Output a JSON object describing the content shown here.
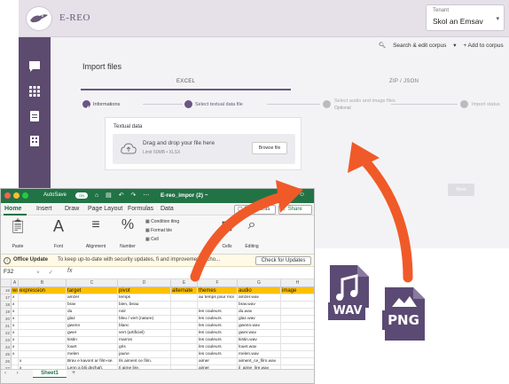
{
  "app": {
    "brand": "E-REO",
    "tenant_label": "Tenant",
    "tenant_value": "Skol an Emsav",
    "actions": {
      "search": "Search & edit corpus",
      "add": "+ Add to corpus"
    },
    "page_title": "Import files",
    "tabs": [
      {
        "label": "EXCEL"
      },
      {
        "label": "ZIP / JSON"
      }
    ],
    "steps": [
      {
        "label": "Informations",
        "state": "done"
      },
      {
        "label": "Select textual data file",
        "state": "active"
      },
      {
        "label": "Select audio and image files",
        "sub": "Optional",
        "state": "todo"
      },
      {
        "label": "Import status",
        "state": "todo"
      }
    ],
    "card": {
      "title": "Textual data",
      "drop_text": "Drag and drop your file here",
      "limit": "Limit 50MB • XLSX",
      "browse": "Browse file"
    },
    "next": "Next",
    "colors": {
      "accent": "#6b5583",
      "sidebar": "#5d4a6f",
      "arrow": "#f05a28"
    }
  },
  "excel": {
    "autosave": "AutoSave",
    "toggle": "ON",
    "filename": "E-reo_impor",
    "filename_suffix": "(2) ~",
    "menu": [
      "Home",
      "Insert",
      "Draw",
      "Page Layout",
      "Formulas",
      "Data"
    ],
    "comments": "Comments",
    "share": "Share",
    "ribbon": {
      "paste": "Paste",
      "font": "Font",
      "alignment": "Alignment",
      "number": "Number",
      "conditional": "Condition",
      "formatting": "tting",
      "format": "Format",
      "format2": "ble",
      "cell": "Cell",
      "cells": "Cells",
      "editing": "Editing"
    },
    "update_title": "Office Update",
    "update_msg": "To keep up-to-date with security updates, fi",
    "update_msg2": "and improvements, cho...",
    "check_updates": "Check for Updates",
    "namebox": "F32",
    "fx": "fx",
    "columns": [
      "A",
      "B",
      "C",
      "D",
      "E",
      "F",
      "G",
      "H"
    ],
    "header_row_num": "16",
    "headers": [
      "word",
      "expression",
      "target",
      "pivot",
      "alternate",
      "themes",
      "audio",
      "image"
    ],
    "rows": [
      {
        "n": "17",
        "cells": [
          "x",
          "",
          "amzer",
          "temps",
          "",
          "au temps pour moi",
          "amzer.wav",
          ""
        ]
      },
      {
        "n": "18",
        "cells": [
          "x",
          "",
          "brav",
          "bien, beau",
          "",
          "",
          "brav.wav",
          ""
        ]
      },
      {
        "n": "19",
        "cells": [
          "x",
          "",
          "du",
          "noir",
          "",
          "les couleurs",
          "du.wav",
          ""
        ]
      },
      {
        "n": "20",
        "cells": [
          "x",
          "",
          "glaz",
          "bleu / vert (nature)",
          "",
          "les couleurs",
          "glaz.wav",
          ""
        ]
      },
      {
        "n": "21",
        "cells": [
          "x",
          "",
          "gwenn",
          "blanc",
          "",
          "les couleurs",
          "gwenn.wav",
          ""
        ]
      },
      {
        "n": "22",
        "cells": [
          "x",
          "",
          "gwer",
          "vert (artificiel)",
          "",
          "les couleurs",
          "gwer.wav",
          ""
        ]
      },
      {
        "n": "23",
        "cells": [
          "x",
          "",
          "kistin",
          "marron",
          "",
          "les couleurs",
          "kistin.wav",
          ""
        ]
      },
      {
        "n": "24",
        "cells": [
          "x",
          "",
          "louet",
          "gris",
          "",
          "les couleurs",
          "louet.wav",
          ""
        ]
      },
      {
        "n": "25",
        "cells": [
          "x",
          "",
          "melen",
          "jaune",
          "",
          "les couleurs",
          "melen.wav",
          ""
        ]
      },
      {
        "n": "26",
        "cells": [
          "",
          "x",
          "Brav e kavont ar film-se.",
          "Ils aiment ce film.",
          "",
          "aimer",
          "aiment_ce_film.wav",
          ""
        ]
      },
      {
        "n": "27",
        "cells": [
          "",
          "x",
          "Lenn a blij dezhañ.",
          "Il aime lire.",
          "",
          "aimer",
          "il_aime_lire.wav",
          ""
        ]
      },
      {
        "n": "28",
        "cells": [
          "",
          "",
          "",
          "",
          "",
          "",
          "",
          ""
        ]
      },
      {
        "n": "29",
        "cells": [
          "",
          "",
          "",
          "",
          "",
          "",
          "",
          ""
        ]
      }
    ],
    "sheet_tab": "Sheet1",
    "status_left": "Ready",
    "status_acc": "Accessibility: Good to go",
    "zoom": "100%"
  },
  "file_icons": {
    "wav": "WAV",
    "png": "PNG",
    "wav_color": "#5b4a73",
    "png_color": "#5b4a73"
  }
}
